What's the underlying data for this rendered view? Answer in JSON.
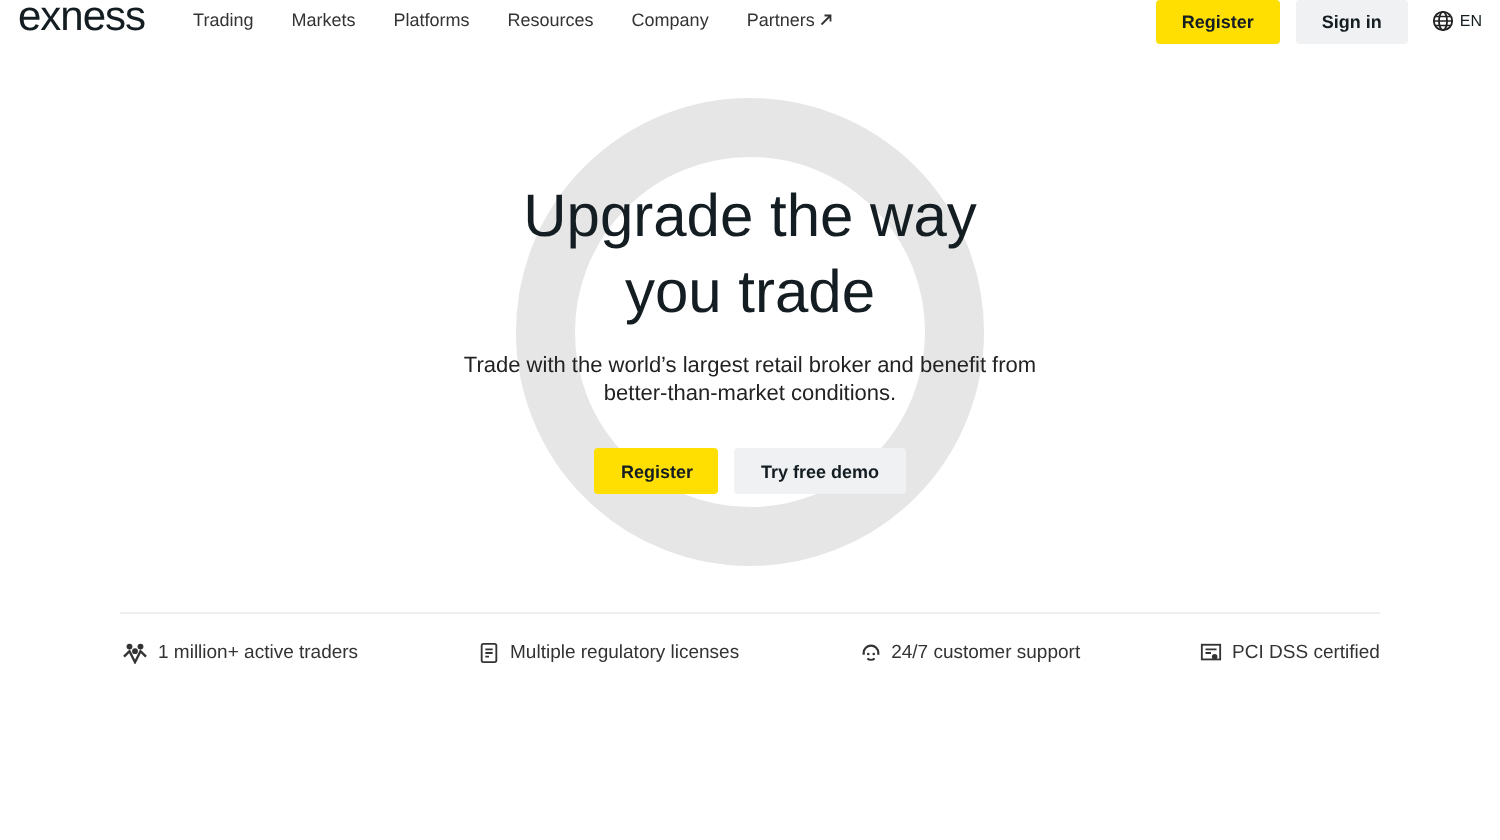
{
  "header": {
    "logo": "exness",
    "nav": [
      {
        "label": "Trading",
        "external": false
      },
      {
        "label": "Markets",
        "external": false
      },
      {
        "label": "Platforms",
        "external": false
      },
      {
        "label": "Resources",
        "external": false
      },
      {
        "label": "Company",
        "external": false
      },
      {
        "label": "Partners",
        "external": true
      }
    ],
    "register": "Register",
    "sign_in": "Sign in",
    "language": "EN"
  },
  "hero": {
    "title_lines": [
      "Upgrade the way",
      "you trade"
    ],
    "subtitle_lines": [
      "Trade with the world’s largest retail broker and benefit from",
      "better-than-market conditions."
    ],
    "primary_button": "Register",
    "secondary_button": "Try free demo"
  },
  "features": [
    {
      "kind": "people",
      "label": "1 million+ active traders"
    },
    {
      "kind": "document",
      "label": "Multiple regulatory licenses"
    },
    {
      "kind": "support",
      "label": "24/7 customer support"
    },
    {
      "kind": "certificate",
      "label": "PCI DSS certified"
    }
  ]
}
